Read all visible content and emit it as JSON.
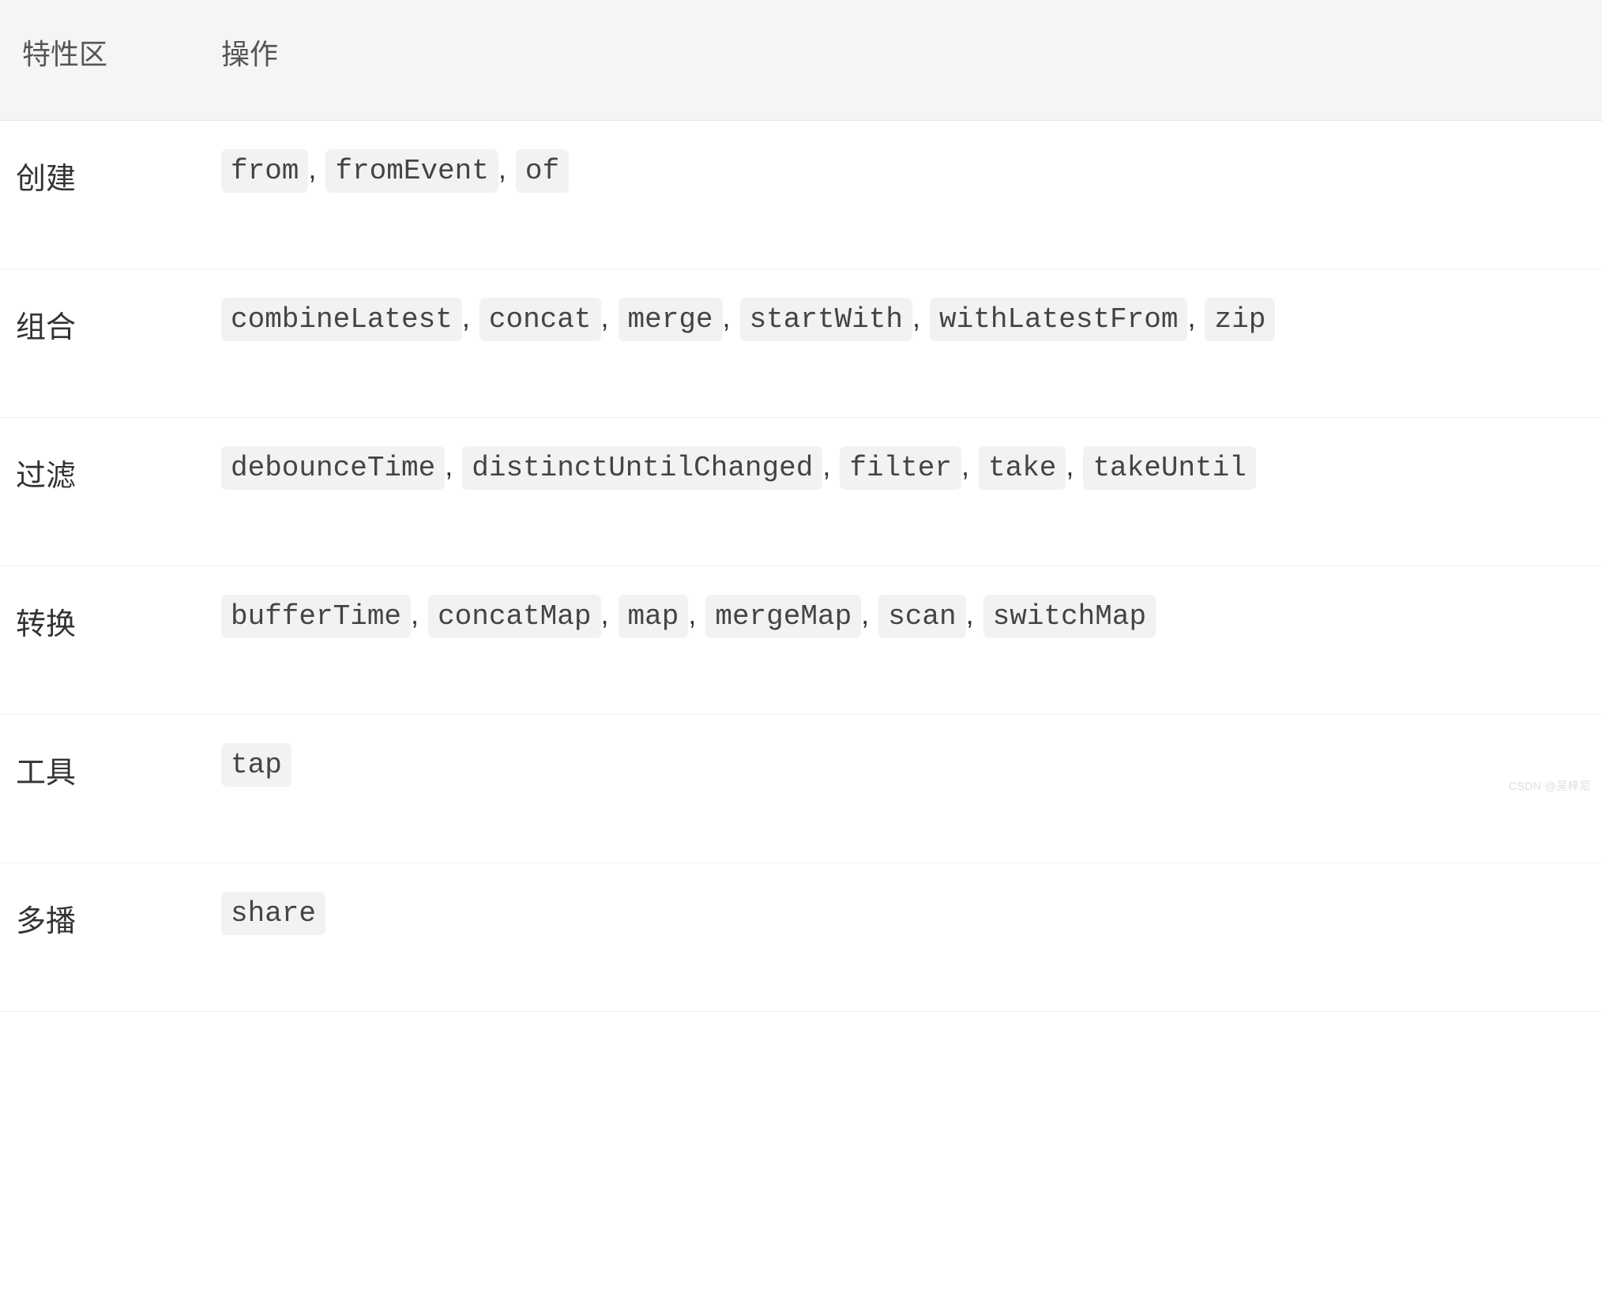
{
  "header": {
    "category_col": "特性区",
    "ops_col": "操作"
  },
  "rows": [
    {
      "category": "创建",
      "ops": [
        "from",
        "fromEvent",
        "of"
      ]
    },
    {
      "category": "组合",
      "ops": [
        "combineLatest",
        "concat",
        "merge",
        "startWith",
        "withLatestFrom",
        "zip"
      ]
    },
    {
      "category": "过滤",
      "ops": [
        "debounceTime",
        "distinctUntilChanged",
        "filter",
        "take",
        "takeUntil"
      ]
    },
    {
      "category": "转换",
      "ops": [
        "bufferTime",
        "concatMap",
        "map",
        "mergeMap",
        "scan",
        "switchMap"
      ]
    },
    {
      "category": "工具",
      "ops": [
        "tap"
      ]
    },
    {
      "category": "多播",
      "ops": [
        "share"
      ]
    }
  ],
  "separator": ",",
  "watermark": "CSDN @吴梓尼"
}
